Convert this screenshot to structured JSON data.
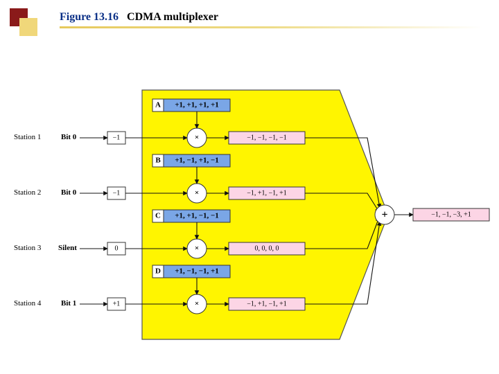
{
  "figure": {
    "number": "Figure 13.16",
    "title": "CDMA multiplexer"
  },
  "stations": [
    {
      "label": "Station 1",
      "input": "Bit 0",
      "value": "−1",
      "codeTag": "A",
      "code": "+1, +1, +1, +1",
      "product": "−1, −1, −1, −1"
    },
    {
      "label": "Station 2",
      "input": "Bit 0",
      "value": "−1",
      "codeTag": "B",
      "code": "+1, −1, +1, −1",
      "product": "−1, +1, −1, +1"
    },
    {
      "label": "Station 3",
      "input": "Silent",
      "value": "0",
      "codeTag": "C",
      "code": "+1, +1, −1, −1",
      "product": "0, 0, 0, 0"
    },
    {
      "label": "Station 4",
      "input": "Bit 1",
      "value": "+1",
      "codeTag": "D",
      "code": "+1, −1, −1, +1",
      "product": "−1, +1, −1, +1"
    }
  ],
  "operators": {
    "mult": "×",
    "add": "+"
  },
  "sum": "−1, −1, −3, +1"
}
